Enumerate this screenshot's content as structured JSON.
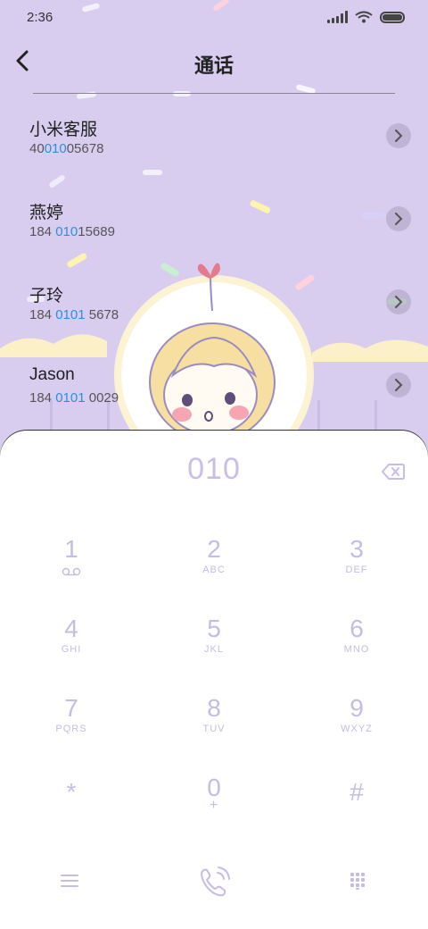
{
  "status": {
    "time": "2:36",
    "signal_icon": "cellular-signal-icon",
    "wifi_icon": "wifi-icon",
    "battery_icon": "battery-icon"
  },
  "header": {
    "title": "通话",
    "back_icon": "chevron-left-icon"
  },
  "contacts": [
    {
      "name": "小米客服",
      "num_pre": "40",
      "num_hl": "010",
      "num_post": "05678"
    },
    {
      "name": "燕婷",
      "num_pre": "184 ",
      "num_hl": "010",
      "num_post": "15689"
    },
    {
      "name": "子玲",
      "num_pre": "184 ",
      "num_hl": "0101",
      "num_post": " 5678"
    },
    {
      "name": "Jason",
      "num_pre": "184 ",
      "num_hl": "0101",
      "num_post": " 0029"
    }
  ],
  "dialer": {
    "input": "010",
    "keys": [
      {
        "digit": "1",
        "letters": ""
      },
      {
        "digit": "2",
        "letters": "ABC"
      },
      {
        "digit": "3",
        "letters": "DEF"
      },
      {
        "digit": "4",
        "letters": "GHI"
      },
      {
        "digit": "5",
        "letters": "JKL"
      },
      {
        "digit": "6",
        "letters": "MNO"
      },
      {
        "digit": "7",
        "letters": "PQRS"
      },
      {
        "digit": "8",
        "letters": "TUV"
      },
      {
        "digit": "9",
        "letters": "WXYZ"
      },
      {
        "digit": "*",
        "letters": ""
      },
      {
        "digit": "0",
        "letters": "+"
      },
      {
        "digit": "#",
        "letters": ""
      }
    ]
  },
  "colors": {
    "background": "#d9cdef",
    "accent": "#c6bce4",
    "highlight": "#2a8fe0"
  }
}
